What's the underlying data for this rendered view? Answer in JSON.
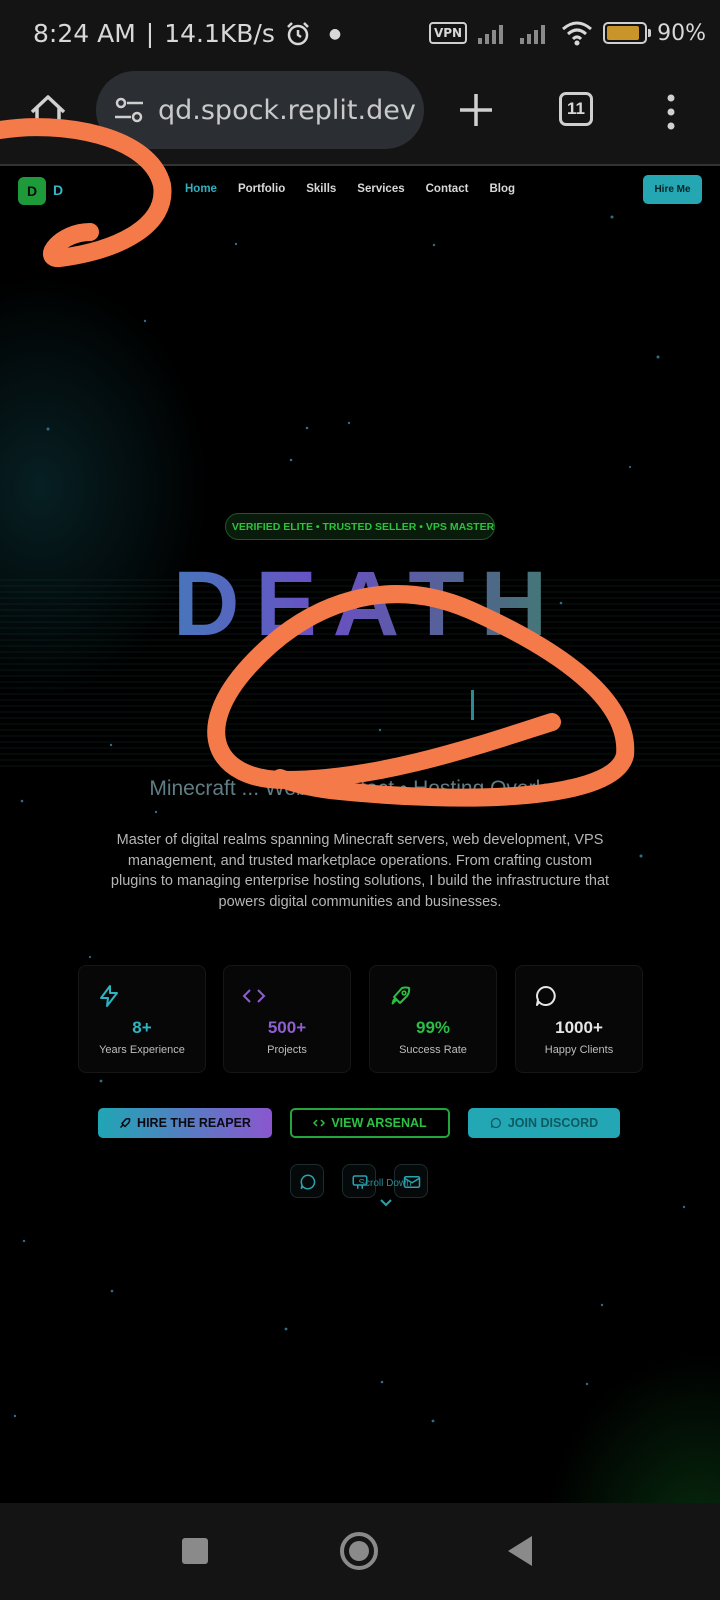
{
  "status_bar": {
    "time": "8:24 AM",
    "separator": "|",
    "net_speed": "14.1KB/s",
    "vpn": "VPN",
    "battery_percent": "90%",
    "battery_level": 0.9,
    "icons": [
      "alarm-icon",
      "signal-icon",
      "signal-icon",
      "wifi-icon",
      "battery-icon"
    ]
  },
  "browser": {
    "url": "qd.spock.replit.dev",
    "tab_count": "11",
    "icons": [
      "home-icon",
      "site-settings-icon",
      "new-tab-icon",
      "tab-switcher-icon",
      "more-menu-icon"
    ]
  },
  "site": {
    "logo": {
      "mark": "D",
      "text": "D"
    },
    "nav": {
      "links": [
        "Home",
        "Portfolio",
        "Skills",
        "Services",
        "Contact",
        "Blog"
      ],
      "active": "Home",
      "hire_label": "Hire Me"
    },
    "hero": {
      "badge": "VERIFIED ELITE • TRUSTED SELLER • VPS MASTER",
      "title": "DEATH",
      "subtitle": "Minecraft ... Web Architect • Hosting Overlord",
      "description": "Master of digital realms spanning Minecraft servers, web development, VPS management, and trusted marketplace operations. From crafting custom plugins to managing enterprise hosting solutions, I build the infrastructure that powers digital communities and businesses."
    },
    "stats": [
      {
        "value": "8+",
        "label": "Years Experience",
        "icon": "lightning-icon",
        "color": "#2db4c2"
      },
      {
        "value": "500+",
        "label": "Projects",
        "icon": "code-icon",
        "color": "#8e5fd0"
      },
      {
        "value": "99%",
        "label": "Success Rate",
        "icon": "rocket-icon",
        "color": "#2bbd44"
      },
      {
        "value": "1000+",
        "label": "Happy Clients",
        "icon": "chat-icon",
        "color": "#e6e6e6"
      }
    ],
    "cta": {
      "hire": "HIRE THE REAPER",
      "arsenal": "VIEW ARSENAL",
      "discord": "JOIN DISCORD"
    },
    "socials": [
      "discord-icon",
      "github-icon",
      "email-icon"
    ],
    "scroll_label": "Scroll Down"
  },
  "colors": {
    "accent_teal": "#24a7b2",
    "accent_purple": "#8b56cf",
    "accent_green": "#23a53d",
    "annotation_orange": "#f57a4a"
  }
}
